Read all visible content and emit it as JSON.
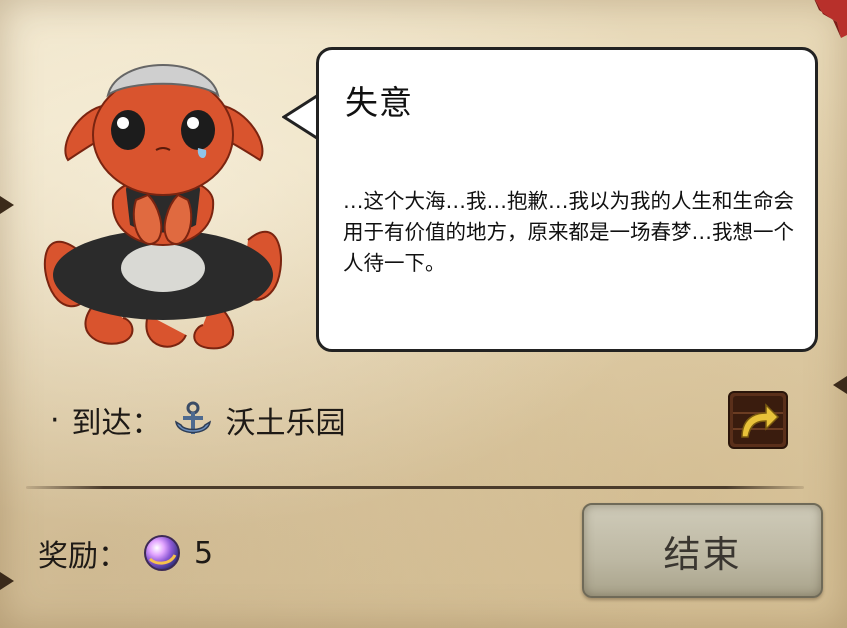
{
  "dialog": {
    "title": "失意",
    "message": "…这个大海…我…抱歉…我以为我的人生和生命会用于有价值的地方，原来都是一场春梦…我想一个人待一下。"
  },
  "destination": {
    "bullet": "·",
    "label": "到达：",
    "icon": "anchor-icon",
    "name": "沃土乐园"
  },
  "share": {
    "icon": "share-arrow-icon"
  },
  "reward": {
    "label": "奖励：",
    "icon": "gem-icon",
    "amount": "5"
  },
  "end_button": {
    "label": "结束"
  },
  "colors": {
    "parchment": "#e6d6b3",
    "octopus": "#d9542e",
    "button": "#bdb8a3",
    "share_bg": "#5a2f1a",
    "share_arrow": "#e8c23a"
  }
}
